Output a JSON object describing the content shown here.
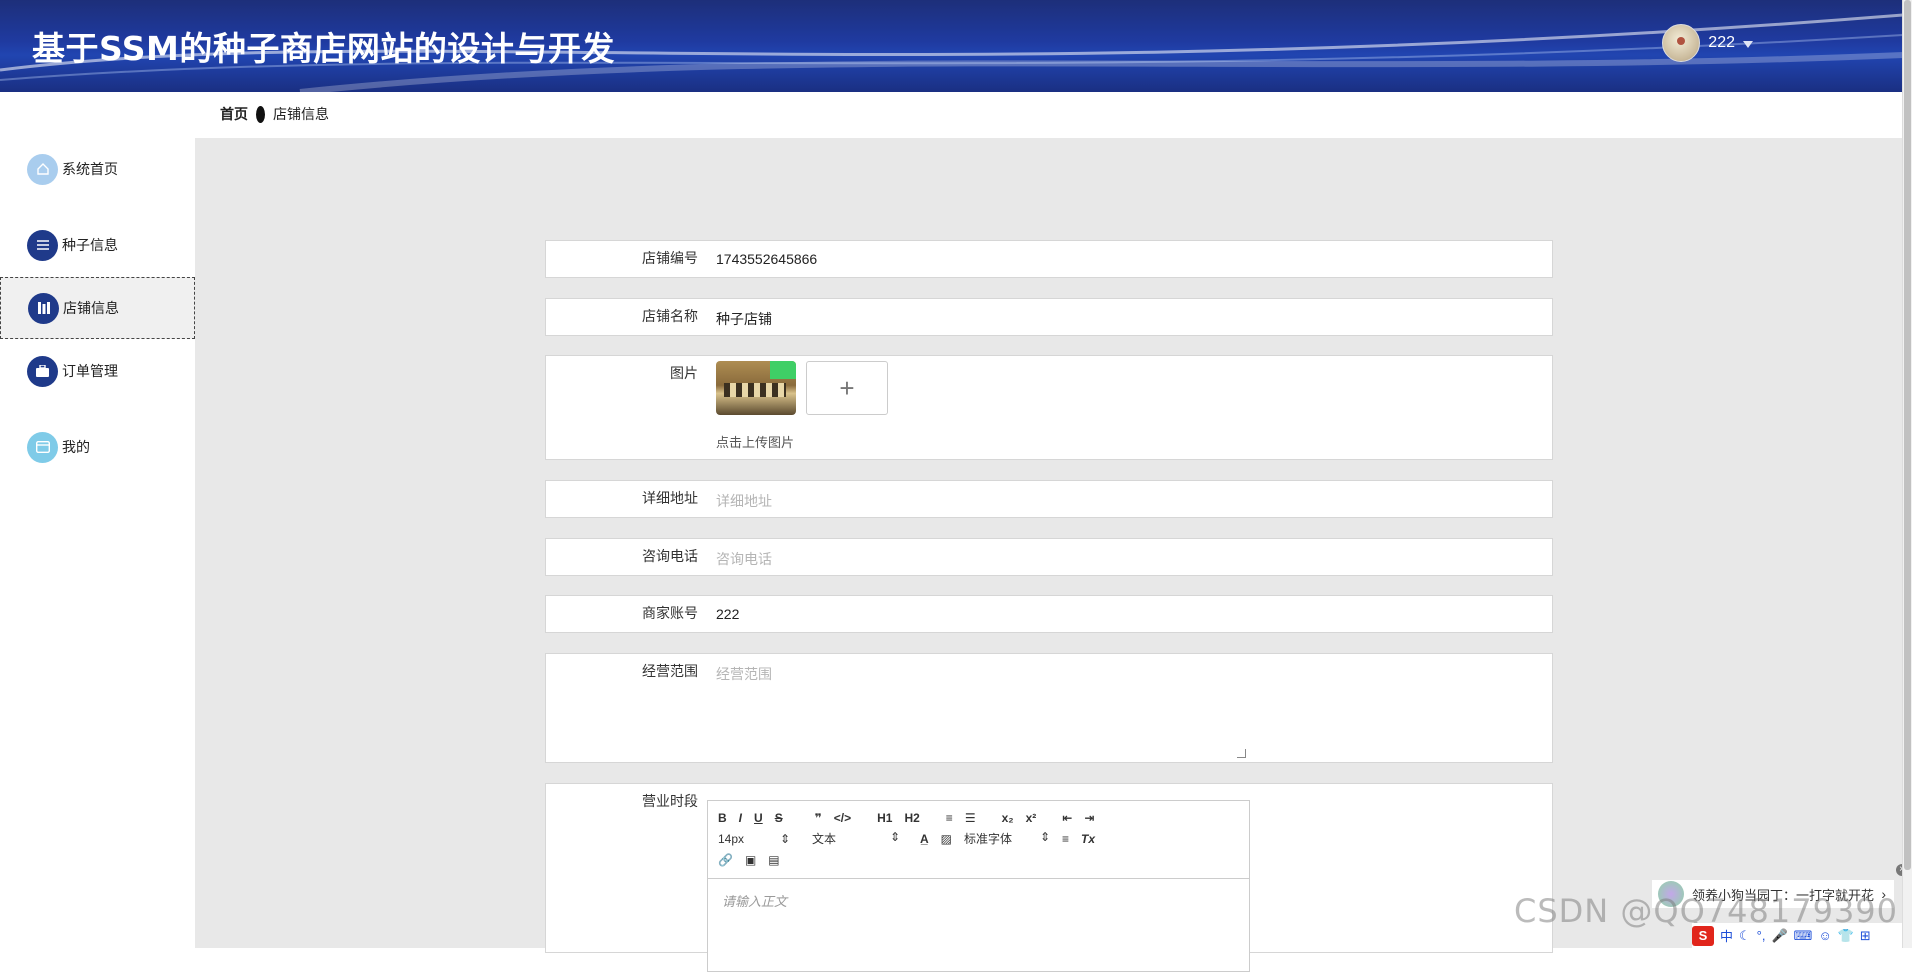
{
  "header": {
    "title": "基于SSM的种子商店网站的设计与开发",
    "username": "222"
  },
  "breadcrumb": {
    "home": "首页",
    "current": "店铺信息"
  },
  "sidebar": {
    "items": [
      {
        "label": "系统首页",
        "icon": "home-icon"
      },
      {
        "label": "种子信息",
        "icon": "list-icon"
      },
      {
        "label": "店铺信息",
        "icon": "store-icon",
        "active": true
      },
      {
        "label": "订单管理",
        "icon": "briefcase-icon"
      },
      {
        "label": "我的",
        "icon": "profile-card-icon"
      }
    ]
  },
  "form": {
    "shop_id": {
      "label": "店铺编号",
      "value": "1743552645866"
    },
    "shop_name": {
      "label": "店铺名称",
      "value": "种子店铺"
    },
    "image": {
      "label": "图片",
      "upload_hint": "点击上传图片",
      "plus": "+"
    },
    "address": {
      "label": "详细地址",
      "placeholder": "详细地址"
    },
    "phone": {
      "label": "咨询电话",
      "placeholder": "咨询电话"
    },
    "merchant_account": {
      "label": "商家账号",
      "value": "222"
    },
    "scope": {
      "label": "经营范围",
      "placeholder": "经营范围"
    },
    "hours": {
      "label": "营业时段"
    }
  },
  "editor": {
    "toolbar_row1": [
      "B",
      "I",
      "U",
      "S",
      "❞",
      "</>",
      "H1",
      "H2",
      "≡",
      "☰",
      "x₂",
      "x²",
      "⇤",
      "⇥"
    ],
    "font_size": "14px",
    "block_type": "文本",
    "font_family": "标准字体",
    "clear_format": "Tx",
    "placeholder": "请输入正文"
  },
  "overlay": {
    "ad_text": "领养小狗当园丁：一打字就开花",
    "watermark": "CSDN @QQ748179390",
    "ime_label": "中"
  },
  "colors": {
    "header_blue": "#1f3aa0",
    "sidebar_icon_dark": "#1f3a8a",
    "sidebar_icon_light": "#a9cdee",
    "content_bg": "#e8e8e8"
  }
}
